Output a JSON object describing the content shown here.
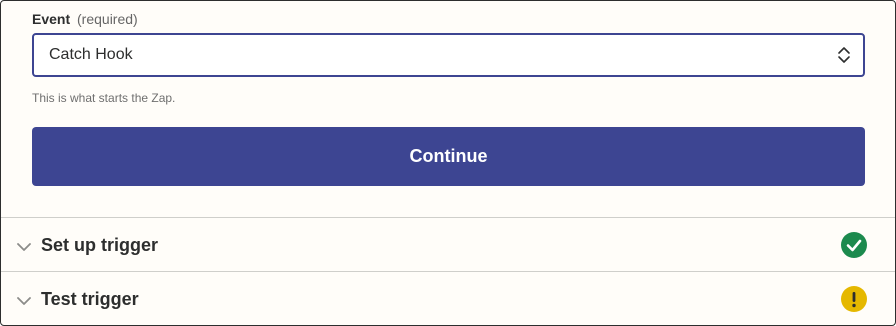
{
  "event_field": {
    "label": "Event",
    "required_note": "(required)",
    "selected_value": "Catch Hook",
    "helper_text": "This is what starts the Zap."
  },
  "continue_button": {
    "label": "Continue"
  },
  "steps": [
    {
      "title": "Set up trigger",
      "status": "complete",
      "status_icon": "check-circle-icon",
      "status_color": "#1c8a4e"
    },
    {
      "title": "Test trigger",
      "status": "warning",
      "status_icon": "exclamation-circle-icon",
      "status_color": "#e5b800"
    }
  ],
  "colors": {
    "accent": "#3d4592",
    "panel_background": "#fffdf9",
    "text": "#2d2e2e"
  }
}
